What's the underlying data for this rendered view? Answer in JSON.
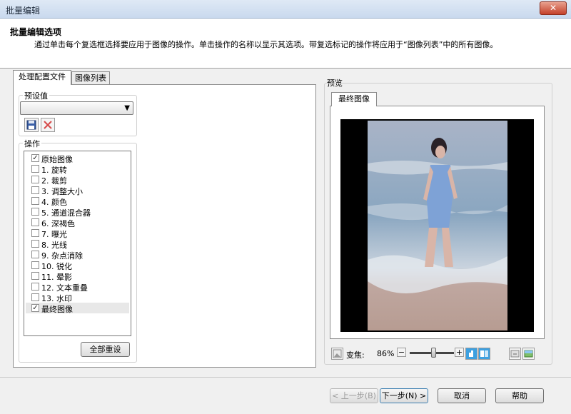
{
  "window": {
    "title": "批量编辑",
    "close_label": "✕"
  },
  "header": {
    "title": "批量编辑选项",
    "description": "通过单击每个复选框选择要应用于图像的操作。单击操作的名称以显示其选项。带复选标记的操作将应用于“图像列表”中的所有图像。"
  },
  "tabs": {
    "profile": "处理配置文件",
    "image_list": "图像列表"
  },
  "preset": {
    "label": "预设值",
    "value": ""
  },
  "operations": {
    "label": "操作",
    "items": [
      {
        "label": "原始图像",
        "checked": true
      },
      {
        "label": "1.  旋转",
        "checked": false
      },
      {
        "label": "2.  裁剪",
        "checked": false
      },
      {
        "label": "3.  调整大小",
        "checked": false
      },
      {
        "label": "4.  颜色",
        "checked": false
      },
      {
        "label": "5.  通道混合器",
        "checked": false
      },
      {
        "label": "6.  深褐色",
        "checked": false
      },
      {
        "label": "7.  曝光",
        "checked": false
      },
      {
        "label": "8.  光线",
        "checked": false
      },
      {
        "label": "9.  杂点消除",
        "checked": false
      },
      {
        "label": "10.  锐化",
        "checked": false
      },
      {
        "label": "11.  晕影",
        "checked": false
      },
      {
        "label": "12.  文本重叠",
        "checked": false
      },
      {
        "label": "13.  水印",
        "checked": false
      },
      {
        "label": "最终图像",
        "checked": true
      }
    ],
    "check_mark": "✓",
    "reset_all_label": "全部重设"
  },
  "preview": {
    "label": "预览",
    "tab_label": "最终图像",
    "zoom_label": "变焦:",
    "zoom_value": "86%",
    "zoom_out": "−",
    "zoom_in": "+"
  },
  "footer": {
    "prev_label": "< 上一步(B)",
    "next_label": "下一步(N) >",
    "cancel_label": "取消",
    "help_label": "帮助"
  },
  "colors": {
    "photo_sky": "#a9b3c6",
    "photo_sea": "#8aa6c0",
    "photo_foam": "#d6dde6",
    "photo_sand": "#b79c92",
    "dress": "#7ea2d6"
  }
}
